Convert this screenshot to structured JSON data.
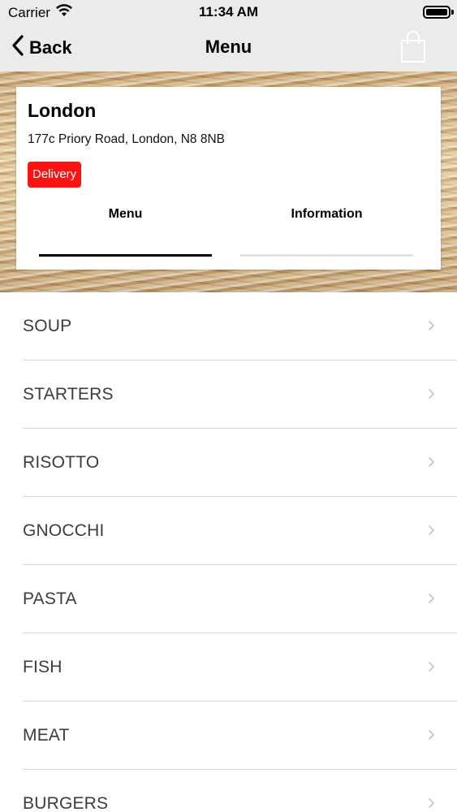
{
  "status_bar": {
    "carrier": "Carrier",
    "time": "11:34 AM"
  },
  "nav": {
    "back_label": "Back",
    "title": "Menu"
  },
  "store": {
    "name": "London",
    "address": "177c Priory Road, London, N8 8NB",
    "badge": "Delivery",
    "badge_color": "#ff1212"
  },
  "tabs": [
    {
      "label": "Menu",
      "active": true
    },
    {
      "label": "Information",
      "active": false
    }
  ],
  "categories": [
    {
      "label": "SOUP"
    },
    {
      "label": "STARTERS"
    },
    {
      "label": "RISOTTO"
    },
    {
      "label": "GNOCCHI"
    },
    {
      "label": "PASTA"
    },
    {
      "label": "FISH"
    },
    {
      "label": "MEAT"
    },
    {
      "label": "BURGERS"
    }
  ],
  "icons": {
    "back": "chevron-left-icon",
    "cart": "shopping-bag-icon",
    "row": "chevron-right-icon"
  }
}
